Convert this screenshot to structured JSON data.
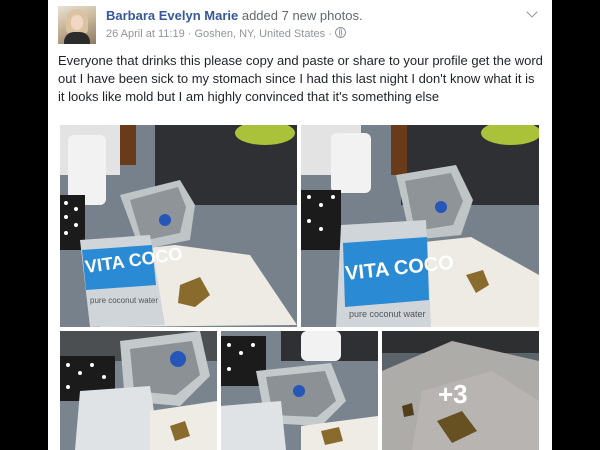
{
  "post": {
    "author": "Barbara Evelyn Marie",
    "action": " added 7 new photos.",
    "meta": "26 April at 11:19 · Goshen, NY, United States ·",
    "text": "Everyone that drinks this please copy and paste or share to your profile get the word out I have been sick to my stomach since I had this last night I don't know what it is it looks like mold but I am highly convinced that it's something else"
  },
  "photos": {
    "brand_text": "VITA COCO",
    "sub_text": "pure coconut water",
    "more_count": "+3"
  },
  "icons": {
    "audience": "globe-icon",
    "options": "chevron-down-icon"
  },
  "colors": {
    "author_link": "#365899",
    "meta_gray": "#90949c",
    "body_text": "#1d2129",
    "can_blue": "#2a8ad4"
  }
}
